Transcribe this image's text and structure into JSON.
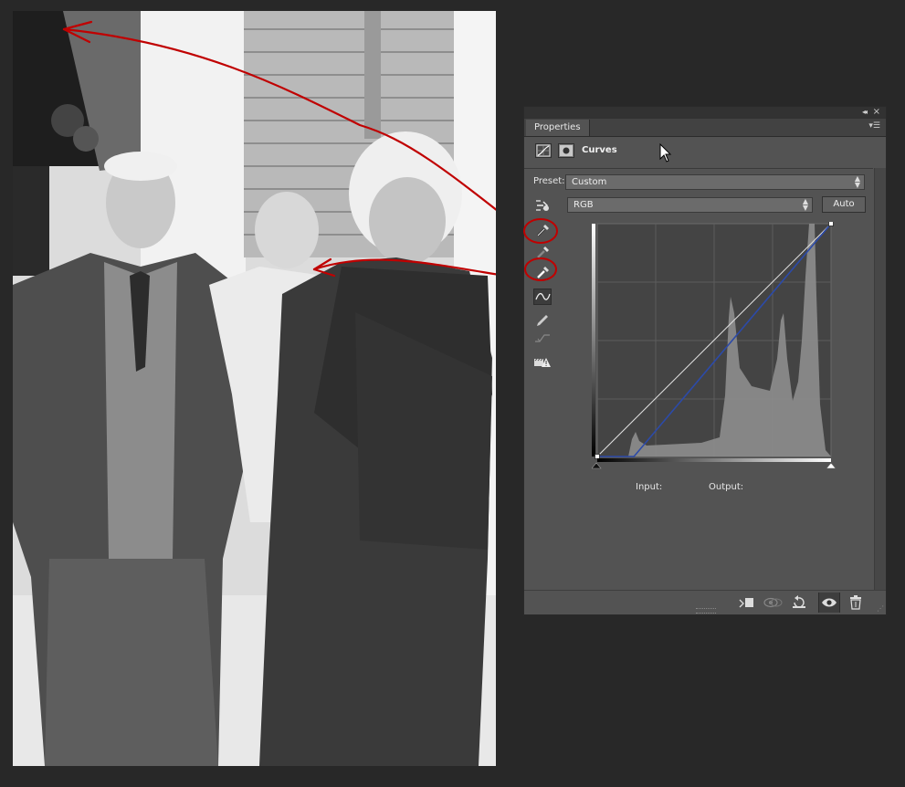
{
  "panel": {
    "tab_label": "Properties",
    "adjustment_title": "Curves",
    "preset_label": "Preset:",
    "preset_value": "Custom",
    "channel_value": "RGB",
    "auto_label": "Auto",
    "input_label": "Input:",
    "output_label": "Output:"
  },
  "icons": {
    "panel_header": [
      "curves-adjustment-icon",
      "layer-mask-icon"
    ],
    "tools": [
      "targeted-adjustment-icon",
      "black-point-eyedropper-icon",
      "gray-point-eyedropper-icon",
      "white-point-eyedropper-icon",
      "edit-points-curve-icon",
      "draw-pencil-icon",
      "smooth-curve-icon",
      "clipping-warning-icon"
    ],
    "bottom": [
      "clip-to-layer-icon",
      "view-previous-state-icon",
      "reset-icon",
      "visibility-eye-icon",
      "delete-icon"
    ]
  },
  "colors": {
    "panel_bg": "#535353",
    "curve": "#2c4aa8",
    "annotation": "#c00000",
    "histogram": "#8a8a8a"
  },
  "curve_points": [
    [
      0,
      0
    ],
    [
      40,
      0
    ],
    [
      255,
      255
    ]
  ]
}
